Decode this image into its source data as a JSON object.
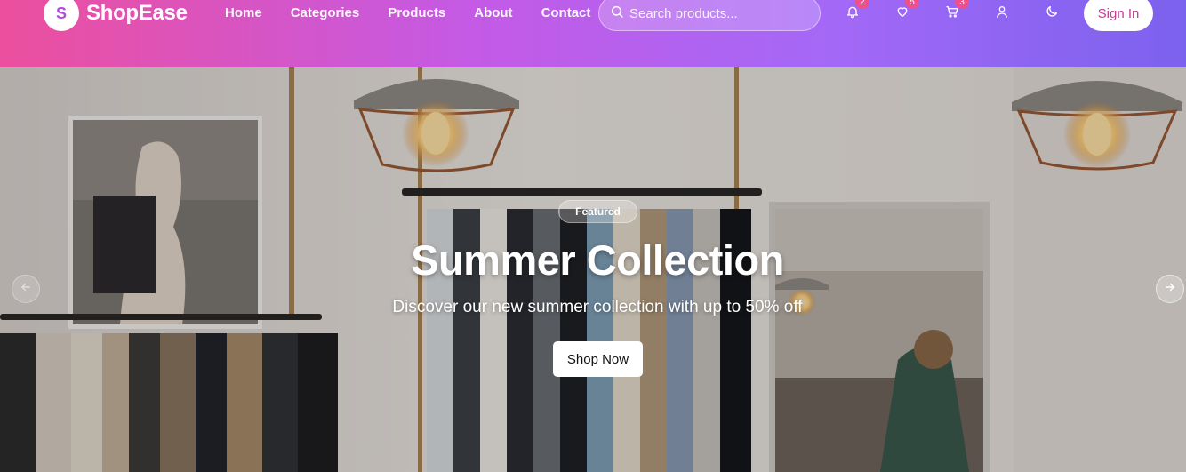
{
  "brand": {
    "logo_letter": "S",
    "name": "ShopEase"
  },
  "nav": {
    "links": [
      "Home",
      "Categories",
      "Products",
      "About",
      "Contact"
    ]
  },
  "search": {
    "placeholder": "Search products..."
  },
  "actions": {
    "notifications_count": "2",
    "wishlist_count": "5",
    "cart_count": "3",
    "sign_in_label": "Sign In"
  },
  "hero": {
    "badge": "Featured",
    "title": "Summer Collection",
    "subtitle": "Discover our new summer collection with up to 50% off",
    "cta_label": "Shop Now"
  },
  "icons": {
    "search": "search-icon",
    "notifications": "bell-icon",
    "wishlist": "heart-icon",
    "cart": "cart-icon",
    "account": "user-icon",
    "theme": "moon-icon",
    "prev": "arrow-left-icon",
    "next": "arrow-right-icon"
  },
  "colors": {
    "gradient_start": "#ec4f9d",
    "gradient_end": "#7b62ee",
    "badge": "#ef4f8b",
    "signin_text": "#c33d95"
  }
}
